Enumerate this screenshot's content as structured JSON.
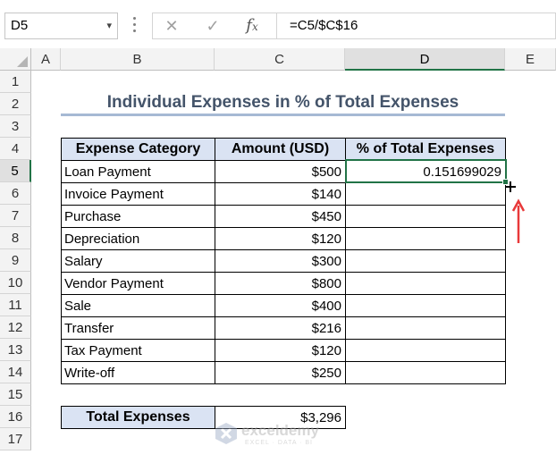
{
  "formula_bar": {
    "name_box": "D5",
    "formula": "=C5/$C$16",
    "icons": [
      "cancel-icon",
      "enter-check-icon",
      "fx-icon"
    ]
  },
  "columns": [
    "A",
    "B",
    "C",
    "D",
    "E"
  ],
  "active_column": "D",
  "rows": [
    "1",
    "2",
    "3",
    "4",
    "5",
    "6",
    "7",
    "8",
    "9",
    "10",
    "11",
    "12",
    "13",
    "14",
    "15",
    "16",
    "17"
  ],
  "active_row": "5",
  "sheet": {
    "title": "Individual Expenses in % of Total Expenses",
    "headers": [
      "Expense Category",
      "Amount (USD)",
      "% of Total Expenses"
    ],
    "table": [
      {
        "category": "Loan Payment",
        "amount": "$500",
        "percent": "0.151699029"
      },
      {
        "category": "Invoice Payment",
        "amount": "$140",
        "percent": ""
      },
      {
        "category": "Purchase",
        "amount": "$450",
        "percent": ""
      },
      {
        "category": "Depreciation",
        "amount": "$120",
        "percent": ""
      },
      {
        "category": "Salary",
        "amount": "$300",
        "percent": ""
      },
      {
        "category": "Vendor Payment",
        "amount": "$800",
        "percent": ""
      },
      {
        "category": "Sale",
        "amount": "$400",
        "percent": ""
      },
      {
        "category": "Transfer",
        "amount": "$216",
        "percent": ""
      },
      {
        "category": "Tax Payment",
        "amount": "$120",
        "percent": ""
      },
      {
        "category": "Write-off",
        "amount": "$250",
        "percent": ""
      }
    ],
    "total_label": "Total Expenses",
    "total_value": "$3,296"
  },
  "watermark": {
    "name": "exceldemy",
    "tagline": "EXCEL · DATA · BI"
  },
  "colors": {
    "header_fill": "#dae3f3",
    "selection": "#217346",
    "title": "#44546a",
    "arrow": "#e8393a"
  }
}
